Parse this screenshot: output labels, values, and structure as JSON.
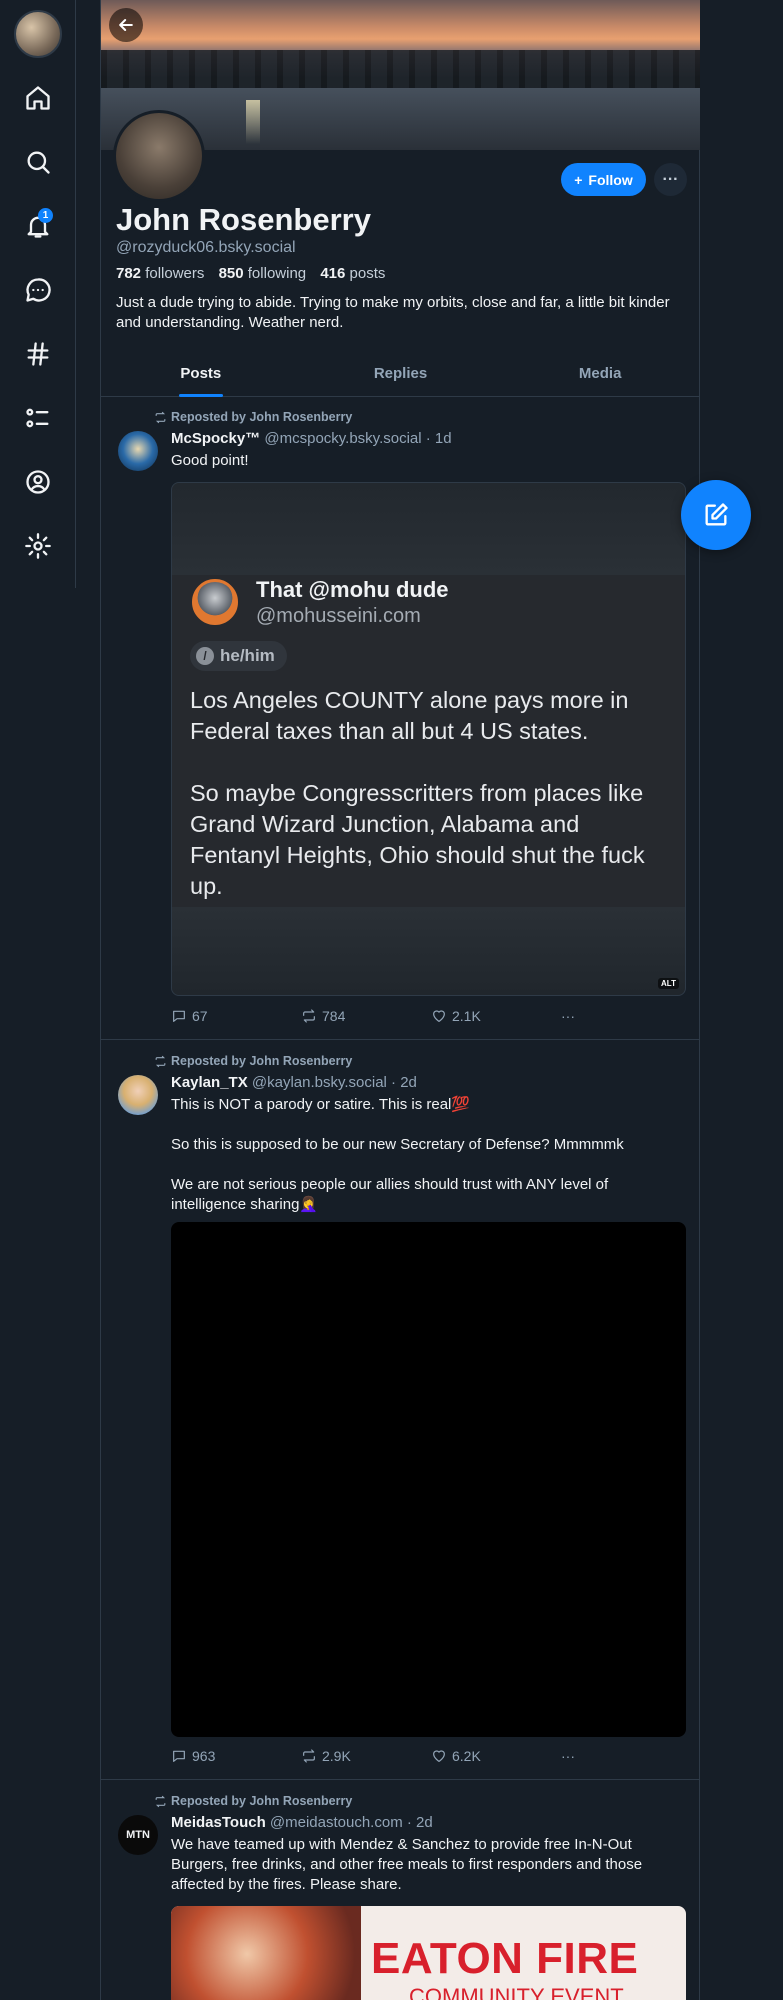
{
  "nav": {
    "badge_count": "1",
    "items": [
      "home-icon",
      "search-icon",
      "notifications-icon",
      "chat-icon",
      "feeds-icon",
      "lists-icon",
      "profile-icon",
      "settings-icon"
    ]
  },
  "profile": {
    "display_name": "John Rosenberry",
    "handle": "@rozyduck06.bsky.social",
    "followers_count": "782",
    "followers_label": "followers",
    "following_count": "850",
    "following_label": "following",
    "posts_count": "416",
    "posts_label": "posts",
    "bio": "Just a dude trying to abide. Trying to make my orbits, close and far, a little bit kinder and understanding. Weather nerd.",
    "follow_label": "Follow",
    "more_label": "···"
  },
  "tabs": [
    {
      "label": "Posts",
      "active": true
    },
    {
      "label": "Replies",
      "active": false
    },
    {
      "label": "Media",
      "active": false
    }
  ],
  "posts": [
    {
      "repost_by": "Reposted by John Rosenberry",
      "author": "McSpocky™",
      "handle": "@mcspocky.bsky.social",
      "time": "· 1d",
      "text": "Good point!",
      "embed": {
        "name": "That @mohu dude",
        "handle": "@mohusseini.com",
        "pronoun": "he/him",
        "text": "Los Angeles COUNTY alone pays more in Federal taxes than all but 4 US states.\n\nSo maybe Congresscritters from places like Grand Wizard Junction, Alabama and Fentanyl Heights, Ohio should shut the fuck up.",
        "alt": "ALT"
      },
      "replies": "67",
      "reposts": "784",
      "likes": "2.1K"
    },
    {
      "repost_by": "Reposted by John Rosenberry",
      "author": "Kaylan_TX",
      "handle": "@kaylan.bsky.social",
      "time": "· 2d",
      "text_lines": [
        "This is NOT a parody or satire. This is real💯",
        "So this is supposed to be our new Secretary of Defense? Mmmmmk",
        "We are not serious people our allies should trust with ANY level of intelligence sharing🤦‍♀️"
      ],
      "replies": "963",
      "reposts": "2.9K",
      "likes": "6.2K"
    },
    {
      "repost_by": "Reposted by John Rosenberry",
      "author": "MeidasTouch",
      "handle": "@meidastouch.com",
      "time": "· 2d",
      "avatar_text": "MTN",
      "text": "We have teamed up with Mendez & Sanchez to provide free In-N-Out Burgers, free drinks, and other free meals  to first responders and those affected by the fires. Please share.",
      "card_title": "EATON FIRE",
      "card_subtitle": "COMMUNITY EVENT"
    }
  ],
  "actions": {
    "more": "···"
  },
  "colors": {
    "accent": "#1083fe",
    "background": "#161e27",
    "border": "#2e3a47",
    "muted": "#93a5b7"
  }
}
